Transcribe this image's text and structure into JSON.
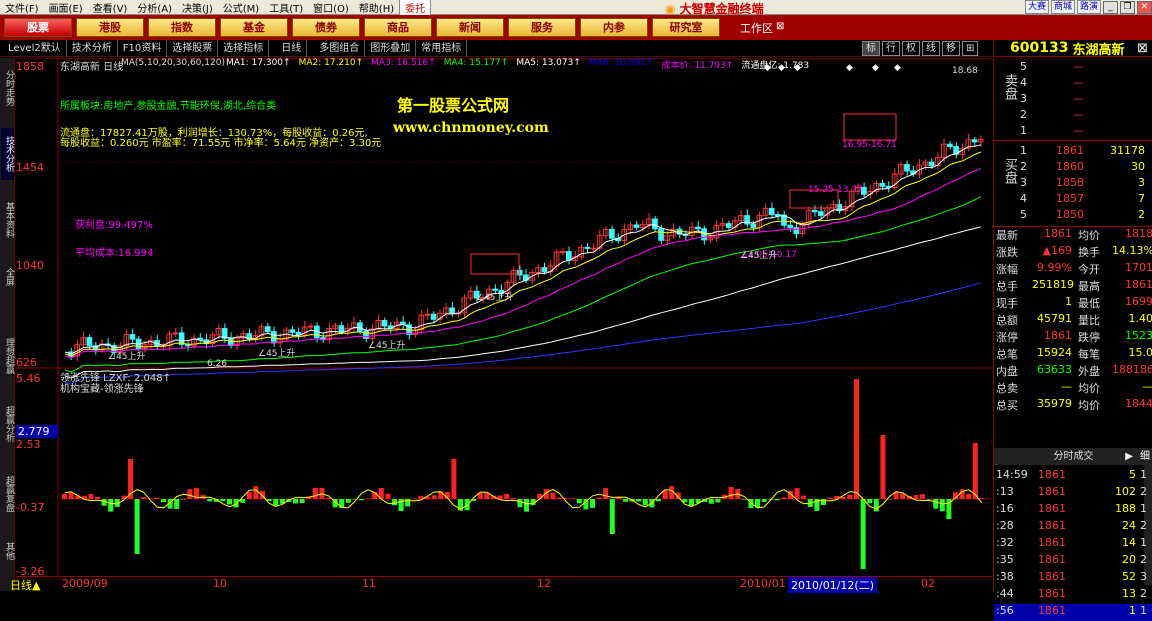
{
  "menubar": {
    "items": [
      "文件(F)",
      "画面(E)",
      "查看(V)",
      "分析(A)",
      "决策(J)",
      "公式(M)",
      "工具(T)",
      "窗口(O)",
      "帮助(H)"
    ],
    "trade_button": "委托",
    "brand_title": "大智慧金融终端",
    "right_buttons": [
      "大赛",
      "商城",
      "路演"
    ]
  },
  "tabs": [
    "股票",
    "港股",
    "指数",
    "基金",
    "债券",
    "商品",
    "新闻",
    "服务",
    "内参",
    "研究室"
  ],
  "workarea": "工作区",
  "toolbar": {
    "items": [
      "Level2默认",
      "技术分析",
      "F10资料",
      "选择股票",
      "选择指标",
      "日线",
      "多图组合",
      "图形叠加",
      "常用指标"
    ],
    "right_ctrls": [
      "标",
      "行",
      "权",
      "线",
      "移"
    ]
  },
  "sidebar": [
    "分时走势",
    "技术分析",
    "基本资料",
    "全屏",
    "理想超赢",
    "超赢分析",
    "超赢复盘",
    "其他"
  ],
  "main_chart": {
    "stock_title": "东湖高新 日线",
    "ma_params": "MA(5,10,20,30,60,120)",
    "ma_values": [
      {
        "label": "MA1: 17.300↑",
        "color": "#ffffff"
      },
      {
        "label": "MA2: 17.210↑",
        "color": "#ffff00"
      },
      {
        "label": "MA3: 16.516↑",
        "color": "#ff00ff"
      },
      {
        "label": "MA4: 15.177↑",
        "color": "#00ff00"
      },
      {
        "label": "MA5: 13.073↑",
        "color": "#ffffff"
      },
      {
        "label": "MA6: 10.091↑",
        "color": "#0000ff"
      },
      {
        "label": "成本价: 11.793↑",
        "color": "#ff00ff"
      },
      {
        "label": "流通盘亿: 1.783",
        "color": "#ffffff"
      }
    ],
    "sector": "所属板块:房地产,参股金融,节能环保,湖北,综合类",
    "info_line1": "流通盘：17827.41万股，利润增长：130.73%，每股收益：0.26元,",
    "info_line2": "每股收益：0.260元 市盈率：71.55元 市净率：5.64元 净资产：3.30元",
    "profit_pct": "获利盘:99.497%",
    "avg_cost": "平均成本:16.994",
    "watermark_title": "第一股票公式网",
    "watermark_url": "www.chnmoney.com",
    "y_labels": [
      "1858",
      "1454",
      "1040",
      "626"
    ],
    "annotations": {
      "high": "18.68",
      "low": "6.26",
      "band1": "16.95-16.71",
      "band2": "15.25-13.77",
      "band3": "11.05-10.17",
      "rise": "∠45上升"
    }
  },
  "indicator": {
    "name": "领涨先锋 LZXF: 2.048↑",
    "sub": "机构宝藏-领涨先锋",
    "y_labels": [
      "5.46",
      "2.53",
      "-0.37",
      "-3.26"
    ],
    "current_value": "2.779"
  },
  "date_axis": {
    "period": "日线",
    "labels": [
      "2009/09",
      "10",
      "11",
      "12",
      "2010/01",
      "02"
    ],
    "highlighted": "2010/01/12(二)"
  },
  "right_panel": {
    "code": "600133",
    "name": "东湖高新",
    "sell_label": "卖盘",
    "buy_label": "买盘",
    "sell_orders": [
      {
        "level": "5",
        "price": "—",
        "vol": ""
      },
      {
        "level": "4",
        "price": "—",
        "vol": ""
      },
      {
        "level": "3",
        "price": "—",
        "vol": ""
      },
      {
        "level": "2",
        "price": "—",
        "vol": ""
      },
      {
        "level": "1",
        "price": "—",
        "vol": ""
      }
    ],
    "buy_orders": [
      {
        "level": "1",
        "price": "1861",
        "vol": "31178"
      },
      {
        "level": "2",
        "price": "1860",
        "vol": "30"
      },
      {
        "level": "3",
        "price": "1858",
        "vol": "3"
      },
      {
        "level": "4",
        "price": "1857",
        "vol": "7"
      },
      {
        "level": "5",
        "price": "1850",
        "vol": "2"
      }
    ],
    "stats": [
      {
        "k1": "最新",
        "v1": "1861",
        "c1": "red",
        "k2": "均价",
        "v2": "1818",
        "c2": "red"
      },
      {
        "k1": "涨跌",
        "v1": "▲169",
        "c1": "red",
        "k2": "换手",
        "v2": "14.13%",
        "c2": "yel"
      },
      {
        "k1": "涨幅",
        "v1": "9.99%",
        "c1": "red",
        "k2": "今开",
        "v2": "1701",
        "c2": "red"
      },
      {
        "k1": "总手",
        "v1": "251819",
        "c1": "yel",
        "k2": "最高",
        "v2": "1861",
        "c2": "red"
      },
      {
        "k1": "现手",
        "v1": "1",
        "c1": "yel",
        "k2": "最低",
        "v2": "1699",
        "c2": "red"
      },
      {
        "k1": "总额",
        "v1": "45791",
        "c1": "yel",
        "k2": "量比",
        "v2": "1.40",
        "c2": "yel"
      },
      {
        "k1": "涨停",
        "v1": "1861",
        "c1": "red",
        "k2": "跌停",
        "v2": "1523",
        "c2": "grn"
      },
      {
        "k1": "总笔",
        "v1": "15924",
        "c1": "yel",
        "k2": "每笔",
        "v2": "15.0",
        "c2": "yel"
      },
      {
        "k1": "内盘",
        "v1": "63633",
        "c1": "grn",
        "k2": "外盘",
        "v2": "188186",
        "c2": "red"
      },
      {
        "k1": "总卖",
        "v1": "—",
        "c1": "yel",
        "k2": "均价",
        "v2": "—",
        "c2": "yel"
      },
      {
        "k1": "总买",
        "v1": "35979",
        "c1": "yel",
        "k2": "均价",
        "v2": "1844",
        "c2": "red"
      }
    ],
    "ticks_title": "分时成交",
    "ticks_detail_btn": "细",
    "ticks": [
      {
        "t": "14:59",
        "p": "1861",
        "v": "5",
        "n": "1"
      },
      {
        "t": ":13",
        "p": "1861",
        "v": "102",
        "n": "2"
      },
      {
        "t": ":16",
        "p": "1861",
        "v": "188",
        "n": "1"
      },
      {
        "t": ":28",
        "p": "1861",
        "v": "24",
        "n": "2"
      },
      {
        "t": ":32",
        "p": "1861",
        "v": "14",
        "n": "1"
      },
      {
        "t": ":35",
        "p": "1861",
        "v": "20",
        "n": "2"
      },
      {
        "t": ":38",
        "p": "1861",
        "v": "52",
        "n": "3"
      },
      {
        "t": ":44",
        "p": "1861",
        "v": "13",
        "n": "2"
      },
      {
        "t": ":56",
        "p": "1861",
        "v": "1",
        "n": "1"
      }
    ]
  }
}
